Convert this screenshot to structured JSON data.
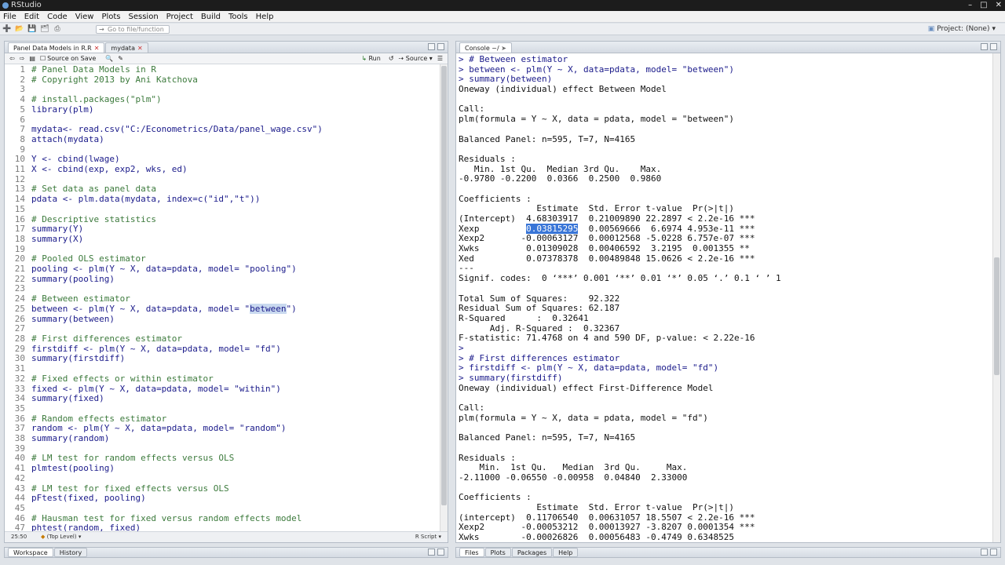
{
  "window": {
    "title": "RStudio"
  },
  "menu": [
    "File",
    "Edit",
    "Code",
    "View",
    "Plots",
    "Session",
    "Project",
    "Build",
    "Tools",
    "Help"
  ],
  "toolbar": {
    "goto_placeholder": "Go to file/function",
    "project": "Project: (None)"
  },
  "editor": {
    "tabs": [
      {
        "label": "Panel Data Models in R.R"
      },
      {
        "label": "mydata"
      }
    ],
    "source_on_save": "Source on Save",
    "run": "Run",
    "source": "Source",
    "lines": [
      "# Panel Data Models in R",
      "# Copyright 2013 by Ani Katchova",
      "",
      "# install.packages(\"plm\")",
      "library(plm)",
      "",
      "mydata<- read.csv(\"C:/Econometrics/Data/panel_wage.csv\")",
      "attach(mydata)",
      "",
      "Y <- cbind(lwage)",
      "X <- cbind(exp, exp2, wks, ed)",
      "",
      "# Set data as panel data",
      "pdata <- plm.data(mydata, index=c(\"id\",\"t\"))",
      "",
      "# Descriptive statistics",
      "summary(Y)",
      "summary(X)",
      "",
      "# Pooled OLS estimator",
      "pooling <- plm(Y ~ X, data=pdata, model= \"pooling\")",
      "summary(pooling)",
      "",
      "# Between estimator",
      "between <- plm(Y ~ X, data=pdata, model= \"between\")",
      "summary(between)",
      "",
      "# First differences estimator",
      "firstdiff <- plm(Y ~ X, data=pdata, model= \"fd\")",
      "summary(firstdiff)",
      "",
      "# Fixed effects or within estimator",
      "fixed <- plm(Y ~ X, data=pdata, model= \"within\")",
      "summary(fixed)",
      "",
      "# Random effects estimator",
      "random <- plm(Y ~ X, data=pdata, model= \"random\")",
      "summary(random)",
      "",
      "# LM test for random effects versus OLS",
      "plmtest(pooling)",
      "",
      "# LM test for fixed effects versus OLS",
      "pFtest(fixed, pooling)",
      "",
      "# Hausman test for fixed versus random effects model",
      "phtest(random, fixed)"
    ],
    "status_pos": "25:50",
    "status_scope": "(Top Level)",
    "status_type": "R Script"
  },
  "console": {
    "tab": "Console ~/",
    "lines": [
      "> # Between estimator",
      "> between <- plm(Y ~ X, data=pdata, model= \"between\")",
      "> summary(between)",
      "Oneway (individual) effect Between Model",
      "",
      "Call:",
      "plm(formula = Y ~ X, data = pdata, model = \"between\")",
      "",
      "Balanced Panel: n=595, T=7, N=4165",
      "",
      "Residuals :",
      "   Min. 1st Qu.  Median 3rd Qu.    Max.",
      "-0.9780 -0.2200  0.0366  0.2500  0.9860",
      "",
      "Coefficients :",
      "               Estimate  Std. Error t-value  Pr(>|t|)",
      "(Intercept)  4.68303917  0.21009890 22.2897 < 2.2e-16 ***",
      "Xexp         0.03815295  0.00569666  6.6974 4.953e-11 ***",
      "Xexp2       -0.00063127  0.00012568 -5.0228 6.757e-07 ***",
      "Xwks         0.01309028  0.00406592  3.2195  0.001355 **",
      "Xed          0.07378378  0.00489848 15.0626 < 2.2e-16 ***",
      "---",
      "Signif. codes:  0 ‘***’ 0.001 ‘**’ 0.01 ‘*’ 0.05 ‘.’ 0.1 ‘ ’ 1",
      "",
      "Total Sum of Squares:    92.322",
      "Residual Sum of Squares: 62.187",
      "R-Squared      :  0.32641",
      "      Adj. R-Squared :  0.32367",
      "F-statistic: 71.4768 on 4 and 590 DF, p-value: < 2.22e-16",
      ">",
      "> # First differences estimator",
      "> firstdiff <- plm(Y ~ X, data=pdata, model= \"fd\")",
      "> summary(firstdiff)",
      "Oneway (individual) effect First-Difference Model",
      "",
      "Call:",
      "plm(formula = Y ~ X, data = pdata, model = \"fd\")",
      "",
      "Balanced Panel: n=595, T=7, N=4165",
      "",
      "Residuals :",
      "    Min.  1st Qu.   Median  3rd Qu.     Max.",
      "-2.11000 -0.06550 -0.00958  0.04840  2.33000",
      "",
      "Coefficients :",
      "               Estimate  Std. Error t-value  Pr(>|t|)",
      "(intercept)  0.11706540  0.00631057 18.5507 < 2.2e-16 ***",
      "Xexp2       -0.00053212  0.00013927 -3.8207 0.0001354 ***",
      "Xwks        -0.00026826  0.00056483 -0.4749 0.6348525"
    ]
  },
  "workspace": {
    "tabs": [
      "Workspace",
      "History"
    ]
  },
  "files": {
    "tabs": [
      "Files",
      "Plots",
      "Packages",
      "Help"
    ]
  }
}
